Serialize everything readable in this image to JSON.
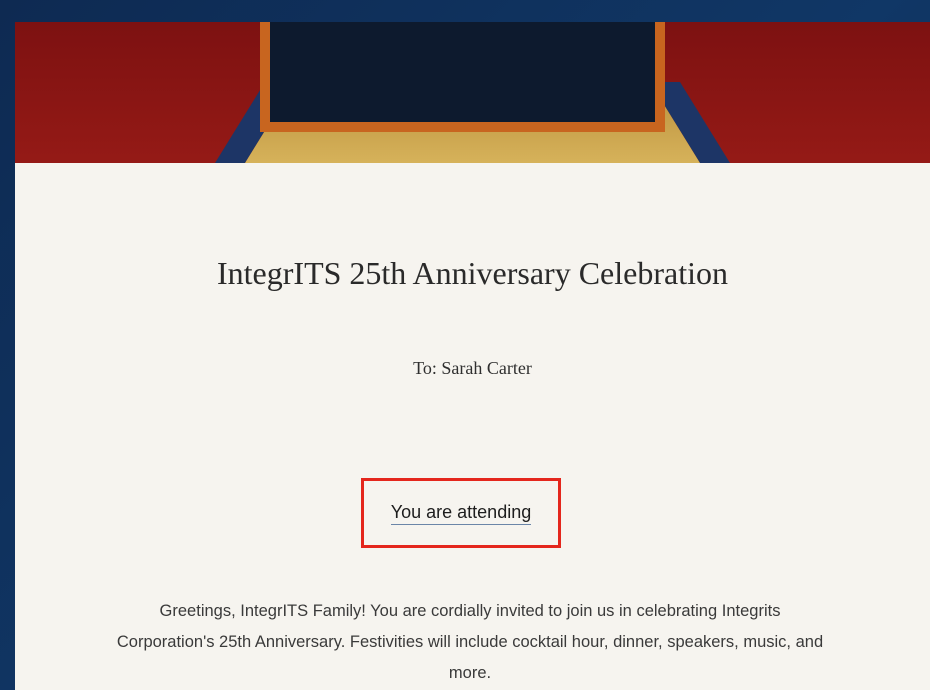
{
  "invitation": {
    "title": "IntegrITS 25th Anniversary Celebration",
    "recipient": "To: Sarah Carter",
    "rsvp_status_link": "You are attending",
    "description": "Greetings, IntegrITS Family! You are cordially invited to join us in celebrating Integrits Corporation's 25th Anniversary. Festivities will include cocktail hour, dinner, speakers, music, and more."
  },
  "colors": {
    "page_background": "#0f2a4d",
    "card_background": "#f6f4ef",
    "banner_red": "#8a1414",
    "banner_gold": "#c9a24a",
    "banner_navy": "#0d1a2e",
    "banner_frame_orange": "#c8651f",
    "highlight_red": "#e4261c"
  }
}
